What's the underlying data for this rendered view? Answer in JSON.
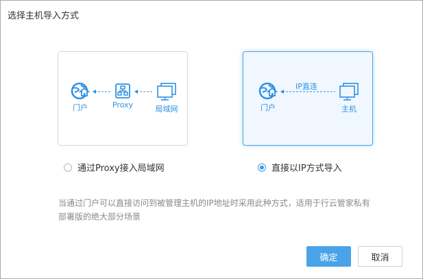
{
  "dialog": {
    "title": "选择主机导入方式",
    "options": [
      {
        "label": "通过Proxy接入局域网",
        "selected": false,
        "diagram": {
          "nodes": [
            {
              "label": "门户",
              "icon": "globe-home-icon"
            },
            {
              "label": "Proxy",
              "icon": "network-hierarchy-icon"
            },
            {
              "label": "局域网",
              "icon": "monitors-icon"
            }
          ]
        }
      },
      {
        "label": "直接以IP方式导入",
        "selected": true,
        "diagram": {
          "connection_label": "IP直连",
          "nodes": [
            {
              "label": "门户",
              "icon": "globe-home-icon"
            },
            {
              "label": "主机",
              "icon": "monitors-icon"
            }
          ]
        }
      }
    ],
    "description": "当通过门户可以直接访问到被管理主机的IP地址时采用此种方式，适用于行云管家私有部署版的绝大部分场景",
    "buttons": {
      "confirm": "确定",
      "cancel": "取消"
    },
    "colors": {
      "accent": "#4aa3e8",
      "icon": "#2e90e3",
      "selected_border": "#4ea3e6"
    }
  }
}
